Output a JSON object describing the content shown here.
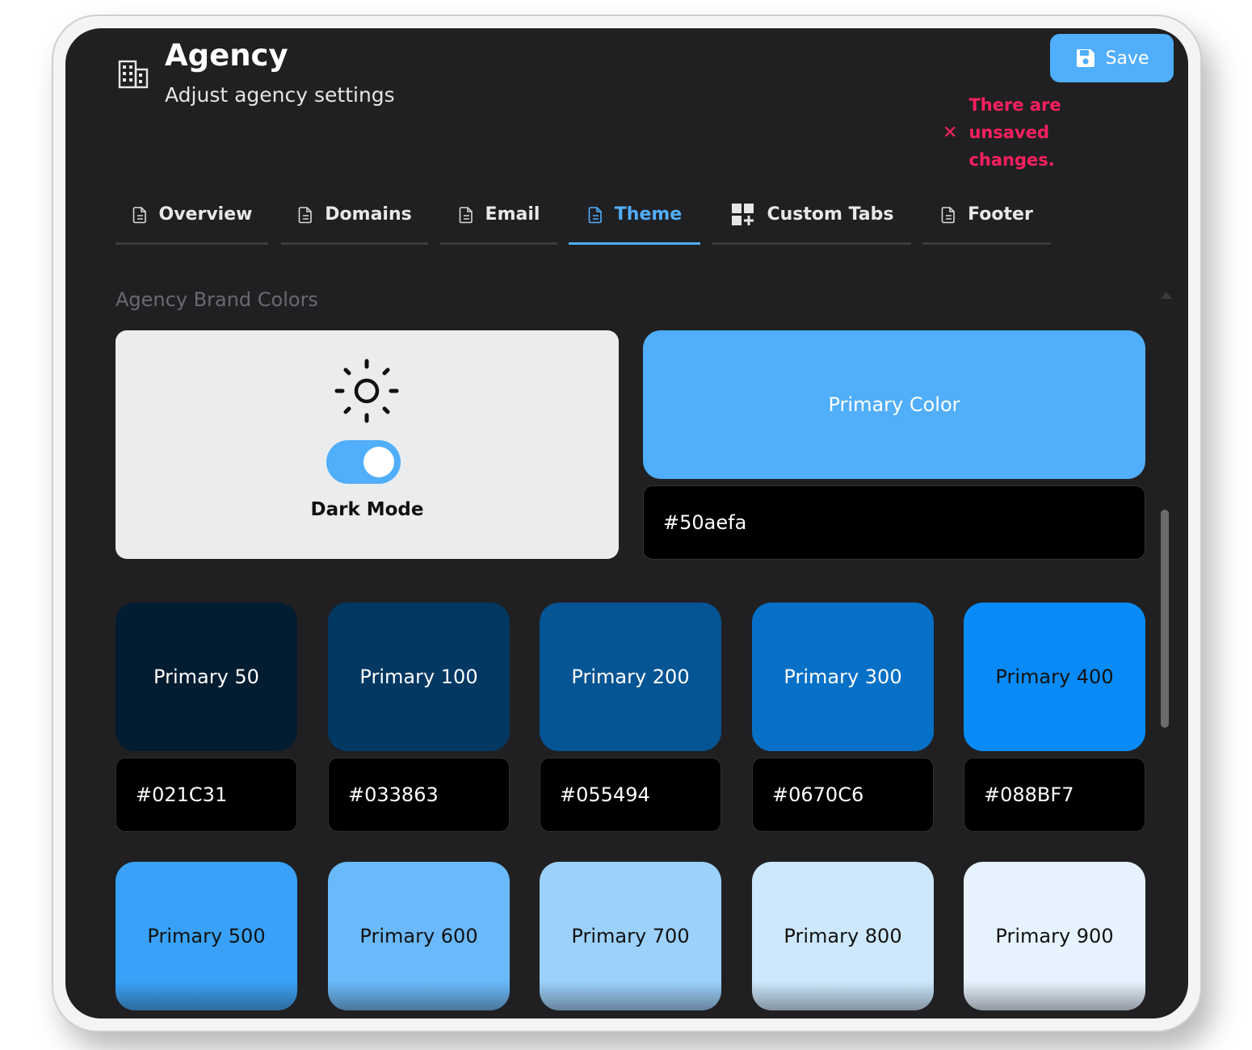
{
  "header": {
    "title": "Agency",
    "subtitle": "Adjust agency settings",
    "icon": "building-icon"
  },
  "toolbar": {
    "save_label": "Save",
    "unsaved_message": "There are unsaved changes."
  },
  "tabs": [
    {
      "label": "Overview",
      "icon": "document-icon"
    },
    {
      "label": "Domains",
      "icon": "document-icon"
    },
    {
      "label": "Email",
      "icon": "document-icon"
    },
    {
      "label": "Theme",
      "icon": "document-icon",
      "active": true
    },
    {
      "label": "Custom Tabs",
      "icon": "grid-plus-icon"
    },
    {
      "label": "Footer",
      "icon": "document-icon"
    }
  ],
  "section": {
    "label": "Agency Brand Colors"
  },
  "dark_mode": {
    "label": "Dark Mode",
    "enabled": true,
    "icon": "sun-icon"
  },
  "primary": {
    "label": "Primary Color",
    "value": "#50aefa"
  },
  "shades": [
    {
      "label": "Primary 50",
      "hex": "#021C31",
      "color": "#021c31",
      "text_color": "#ffffff"
    },
    {
      "label": "Primary 100",
      "hex": "#033863",
      "color": "#033863",
      "text_color": "#ffffff"
    },
    {
      "label": "Primary 200",
      "hex": "#055494",
      "color": "#055494",
      "text_color": "#ffffff"
    },
    {
      "label": "Primary 300",
      "hex": "#0670C6",
      "color": "#0670c6",
      "text_color": "#ffffff"
    },
    {
      "label": "Primary 400",
      "hex": "#088BF7",
      "color": "#088bf7",
      "text_color": "#111111"
    },
    {
      "label": "Primary 500",
      "color": "#39a2f8",
      "text_color": "#111111"
    },
    {
      "label": "Primary 600",
      "color": "#6ab9fa",
      "text_color": "#111111"
    },
    {
      "label": "Primary 700",
      "color": "#9cd1fb",
      "text_color": "#111111"
    },
    {
      "label": "Primary 800",
      "color": "#cde8fd",
      "text_color": "#111111"
    },
    {
      "label": "Primary 900",
      "color": "#e6f3fe",
      "text_color": "#111111"
    }
  ],
  "colors": {
    "accent": "#50aefa",
    "error": "#ff1f5f",
    "background": "#202022"
  }
}
